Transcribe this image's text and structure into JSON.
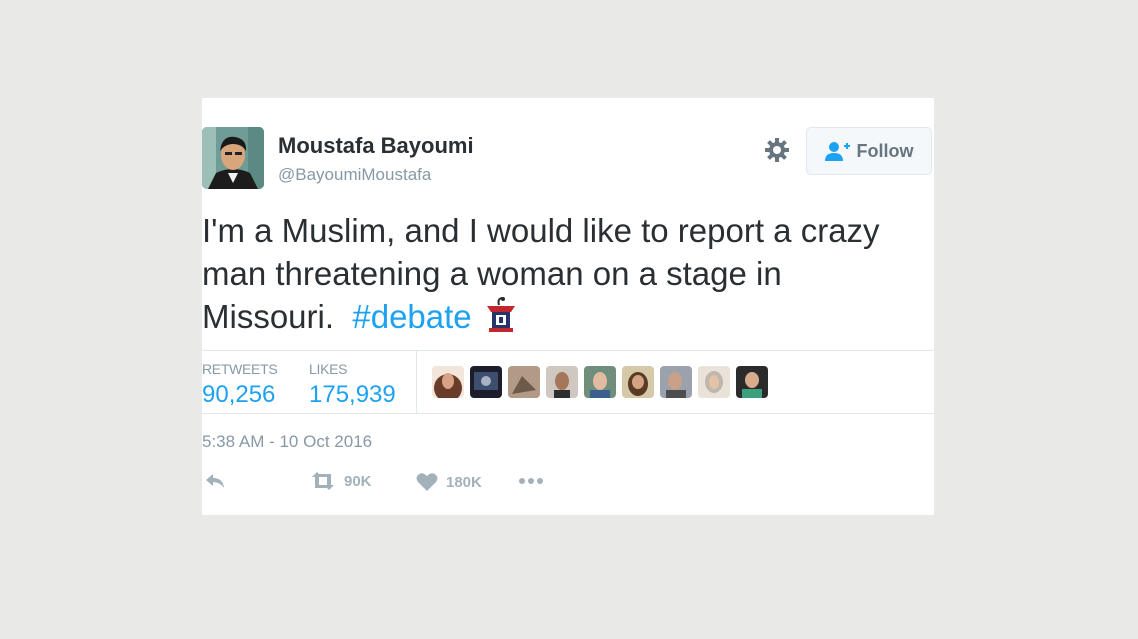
{
  "user": {
    "name": "Moustafa Bayoumi",
    "handle": "@BayoumiMoustafa"
  },
  "follow_label": "Follow",
  "tweet": {
    "text": "I'm a Muslim, and I would like to report a crazy man threatening a woman on a stage in Missouri.",
    "hashtag": "#debate"
  },
  "stats": {
    "retweets_label": "RETWEETS",
    "retweets_value": "90,256",
    "likes_label": "LIKES",
    "likes_value": "175,939"
  },
  "timestamp": "5:38 AM - 10 Oct 2016",
  "actions": {
    "retweet_count": "90K",
    "like_count": "180K"
  },
  "icons": [
    "reply-icon",
    "retweet-icon",
    "heart-icon",
    "more-icon",
    "gear-icon",
    "follow-person-icon",
    "podium-emoji"
  ],
  "colors": {
    "accent": "#1da1f2",
    "text": "#292f33",
    "muted": "#8899a6",
    "background": "#e9e9e7"
  }
}
